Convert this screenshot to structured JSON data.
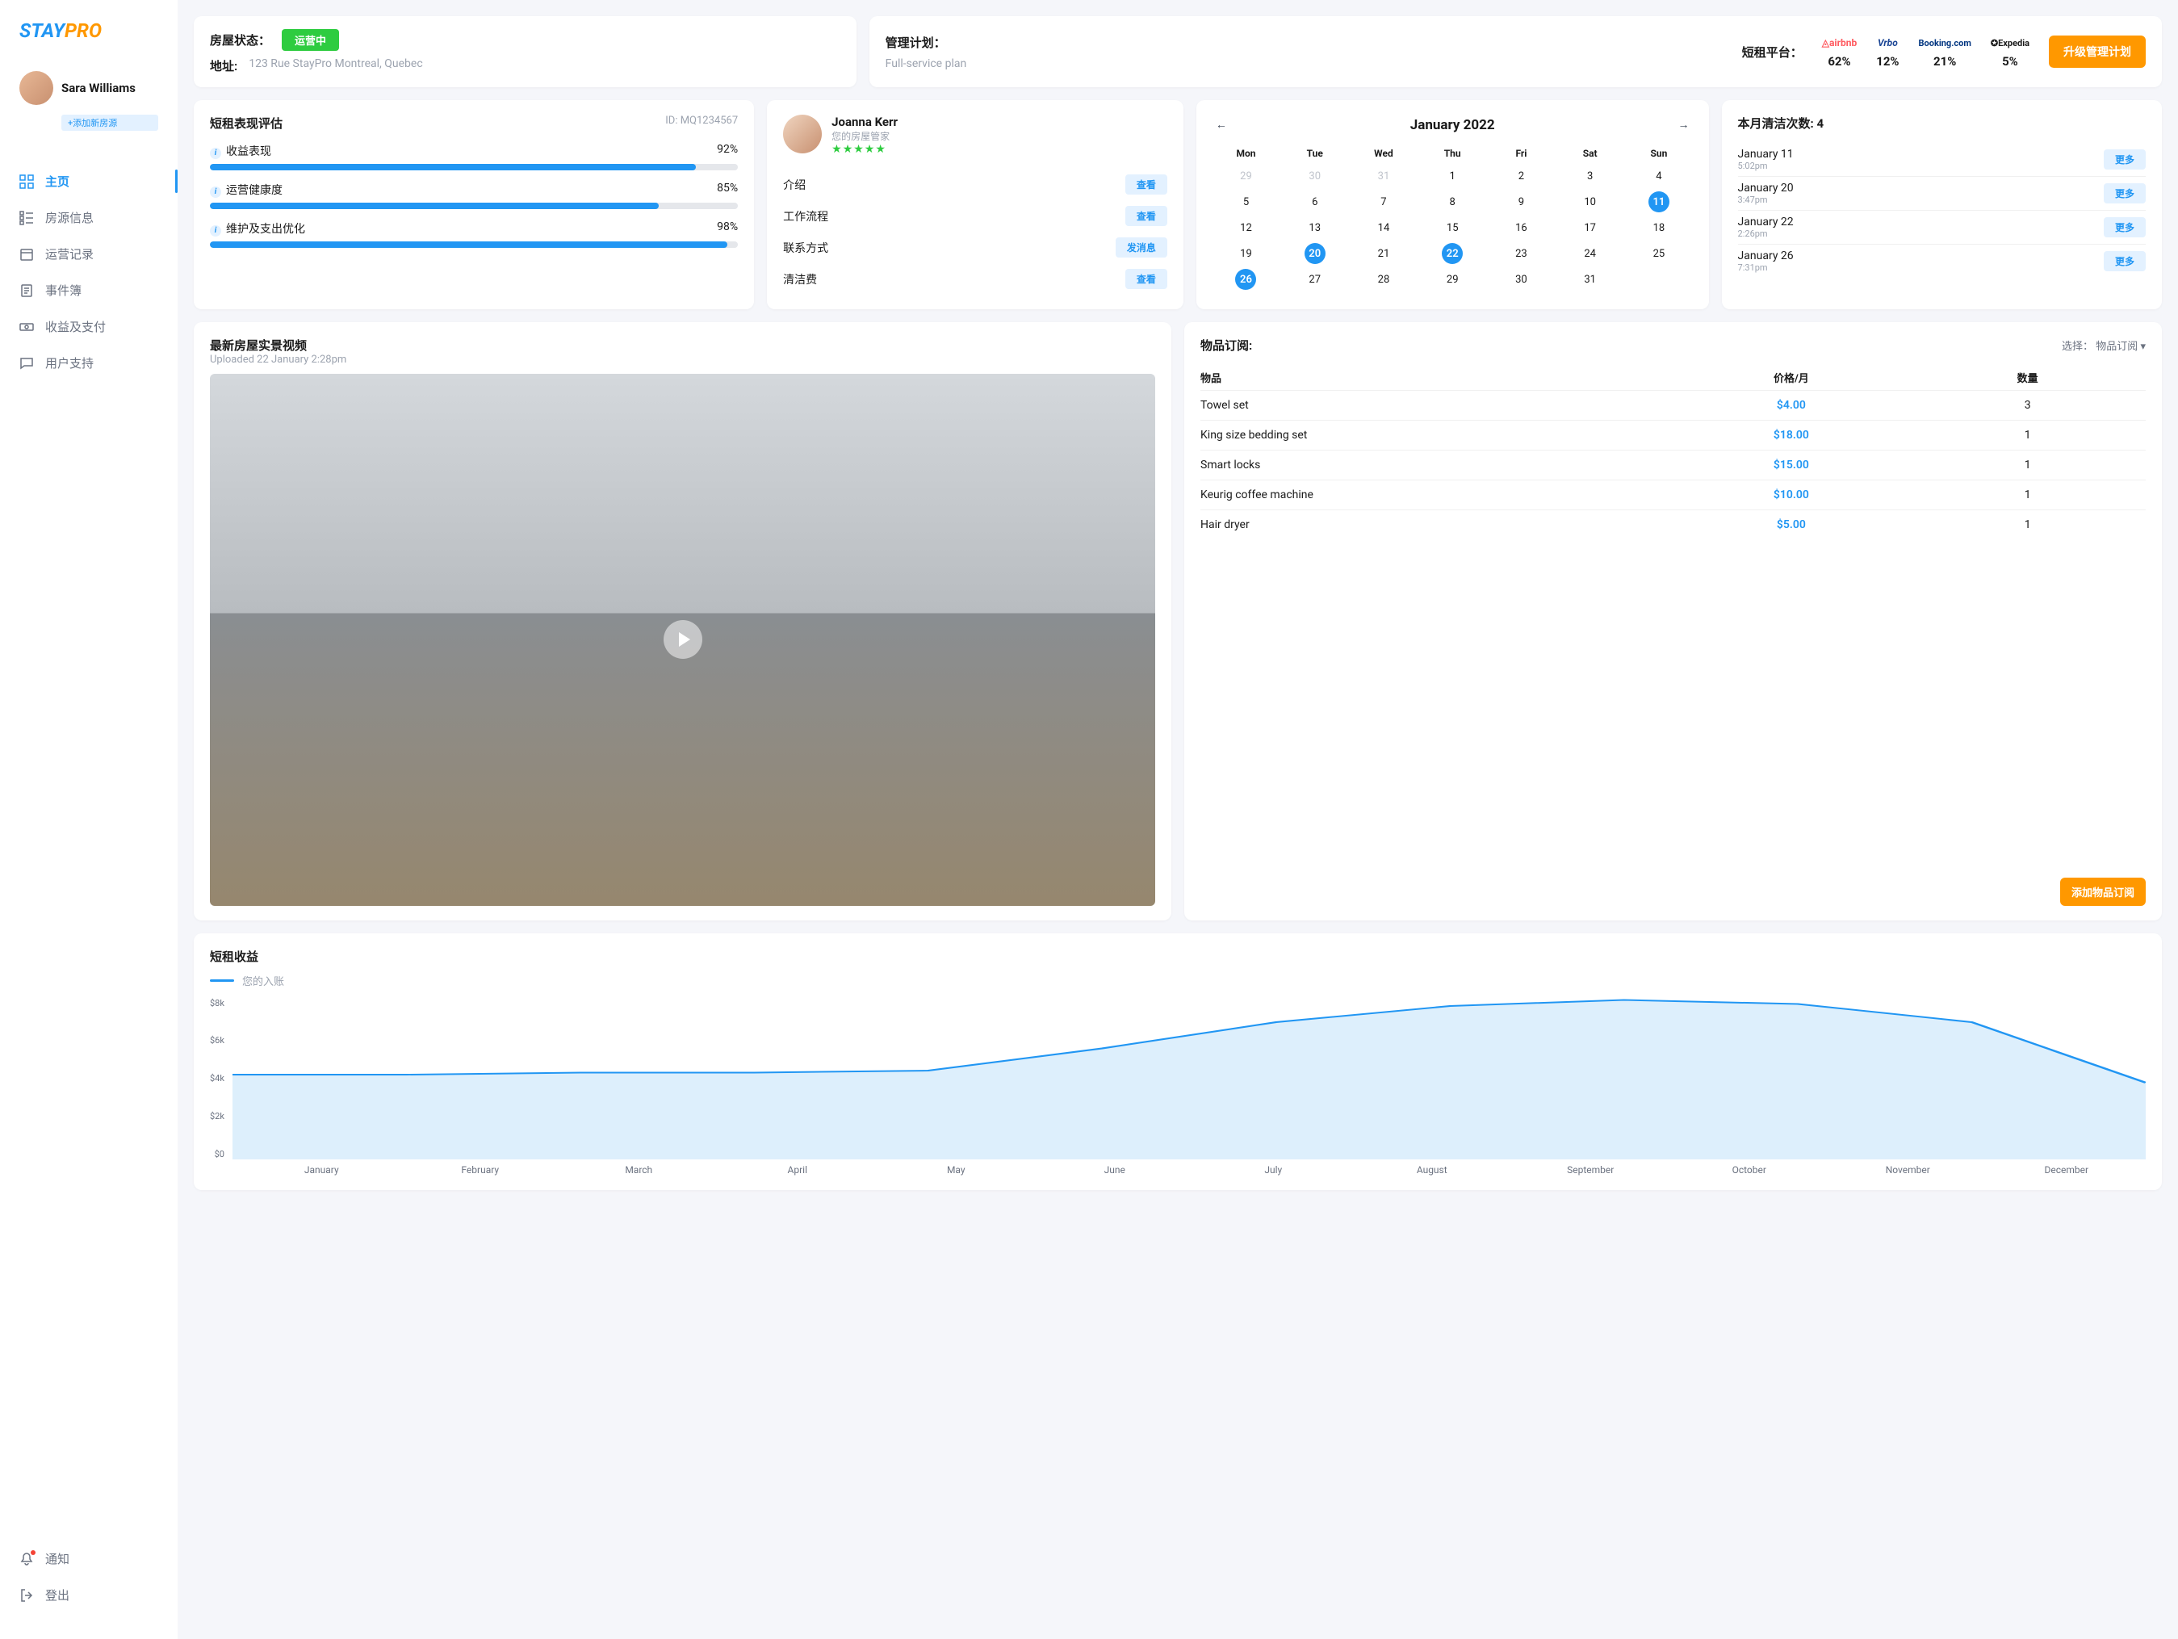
{
  "logo": {
    "s": "S",
    "tay": "TAY",
    "pro": "PRO"
  },
  "user": {
    "name": "Sara Williams",
    "add_property": "+添加新房源"
  },
  "nav": {
    "items": [
      {
        "label": "主页"
      },
      {
        "label": "房源信息"
      },
      {
        "label": "运营记录"
      },
      {
        "label": "事件簿"
      },
      {
        "label": "收益及支付"
      },
      {
        "label": "用户支持"
      }
    ],
    "notify": "通知",
    "logout": "登出"
  },
  "status": {
    "label": "房屋状态：",
    "badge": "运营中",
    "addr_label": "地址:",
    "addr": "123 Rue StayPro Montreal, Quebec",
    "plan_label": "管理计划：",
    "plan_value": "Full-service plan",
    "platform_label": "短租平台：",
    "upgrade": "升级管理计划"
  },
  "platforms": [
    {
      "name": "airbnb",
      "pct": "62%"
    },
    {
      "name": "Vrbo",
      "pct": "12%"
    },
    {
      "name": "Booking.com",
      "pct": "21%"
    },
    {
      "name": "Expedia",
      "pct": "5%"
    }
  ],
  "perf": {
    "title": "短租表现评估",
    "id": "ID: MQ1234567",
    "metrics": [
      {
        "label": "收益表现",
        "pct": "92%",
        "w": 92
      },
      {
        "label": "运营健康度",
        "pct": "85%",
        "w": 85
      },
      {
        "label": "维护及支出优化",
        "pct": "98%",
        "w": 98
      }
    ]
  },
  "keeper": {
    "name": "Joanna Kerr",
    "role": "您的房屋管家",
    "rows": [
      {
        "label": "介绍",
        "btn": "查看"
      },
      {
        "label": "工作流程",
        "btn": "查看"
      },
      {
        "label": "联系方式",
        "btn": "发消息"
      },
      {
        "label": "清洁费",
        "btn": "查看"
      }
    ]
  },
  "calendar": {
    "title": "January 2022",
    "dow": [
      "Mon",
      "Tue",
      "Wed",
      "Thu",
      "Fri",
      "Sat",
      "Sun"
    ],
    "cells": [
      {
        "n": "29",
        "out": true
      },
      {
        "n": "30",
        "out": true
      },
      {
        "n": "31",
        "out": true
      },
      {
        "n": "1"
      },
      {
        "n": "2"
      },
      {
        "n": "3"
      },
      {
        "n": "4"
      },
      {
        "n": "5"
      },
      {
        "n": "6"
      },
      {
        "n": "7"
      },
      {
        "n": "8"
      },
      {
        "n": "9"
      },
      {
        "n": "10"
      },
      {
        "n": "11",
        "hl": true
      },
      {
        "n": "12"
      },
      {
        "n": "13"
      },
      {
        "n": "14"
      },
      {
        "n": "15"
      },
      {
        "n": "16"
      },
      {
        "n": "17"
      },
      {
        "n": "18"
      },
      {
        "n": "19"
      },
      {
        "n": "20",
        "hl": true
      },
      {
        "n": "21"
      },
      {
        "n": "22",
        "hl": true
      },
      {
        "n": "23"
      },
      {
        "n": "24"
      },
      {
        "n": "25"
      },
      {
        "n": "26",
        "hl": true
      },
      {
        "n": "27"
      },
      {
        "n": "28"
      },
      {
        "n": "29"
      },
      {
        "n": "30"
      },
      {
        "n": "31"
      }
    ]
  },
  "cleanings": {
    "title": "本月清洁次数: 4",
    "items": [
      {
        "date": "January 11",
        "time": "5:02pm",
        "btn": "更多"
      },
      {
        "date": "January 20",
        "time": "3:47pm",
        "btn": "更多"
      },
      {
        "date": "January 22",
        "time": "2:26pm",
        "btn": "更多"
      },
      {
        "date": "January 26",
        "time": "7:31pm",
        "btn": "更多"
      }
    ]
  },
  "video": {
    "title": "最新房屋实景视频",
    "sub": "Uploaded 22 January 2:28pm"
  },
  "subs": {
    "title": "物品订阅:",
    "select_label": "选择：",
    "select_value": "物品订阅",
    "th": [
      "物品",
      "价格/月",
      "数量"
    ],
    "rows": [
      {
        "name": "Towel set",
        "price": "$4.00",
        "qty": "3"
      },
      {
        "name": "King size bedding set",
        "price": "$18.00",
        "qty": "1"
      },
      {
        "name": "Smart locks",
        "price": "$15.00",
        "qty": "1"
      },
      {
        "name": "Keurig coffee machine",
        "price": "$10.00",
        "qty": "1"
      },
      {
        "name": "Hair dryer",
        "price": "$5.00",
        "qty": "1"
      }
    ],
    "add_btn": "添加物品订阅"
  },
  "chart": {
    "title": "短租收益",
    "legend": "您的入账",
    "ylabels": [
      "$8k",
      "$6k",
      "$4k",
      "$2k",
      "$0"
    ],
    "xlabels": [
      "January",
      "February",
      "March",
      "April",
      "May",
      "June",
      "July",
      "August",
      "September",
      "October",
      "November",
      "December"
    ]
  },
  "chart_data": {
    "type": "area",
    "title": "短租收益",
    "series": [
      {
        "name": "您的入账",
        "values": [
          4.2,
          4.2,
          4.3,
          4.3,
          4.4,
          5.5,
          6.8,
          7.6,
          7.9,
          7.7,
          6.8,
          3.8
        ]
      }
    ],
    "categories": [
      "January",
      "February",
      "March",
      "April",
      "May",
      "June",
      "July",
      "August",
      "September",
      "October",
      "November",
      "December"
    ],
    "ylabel": "$k",
    "ylim": [
      0,
      8
    ]
  }
}
